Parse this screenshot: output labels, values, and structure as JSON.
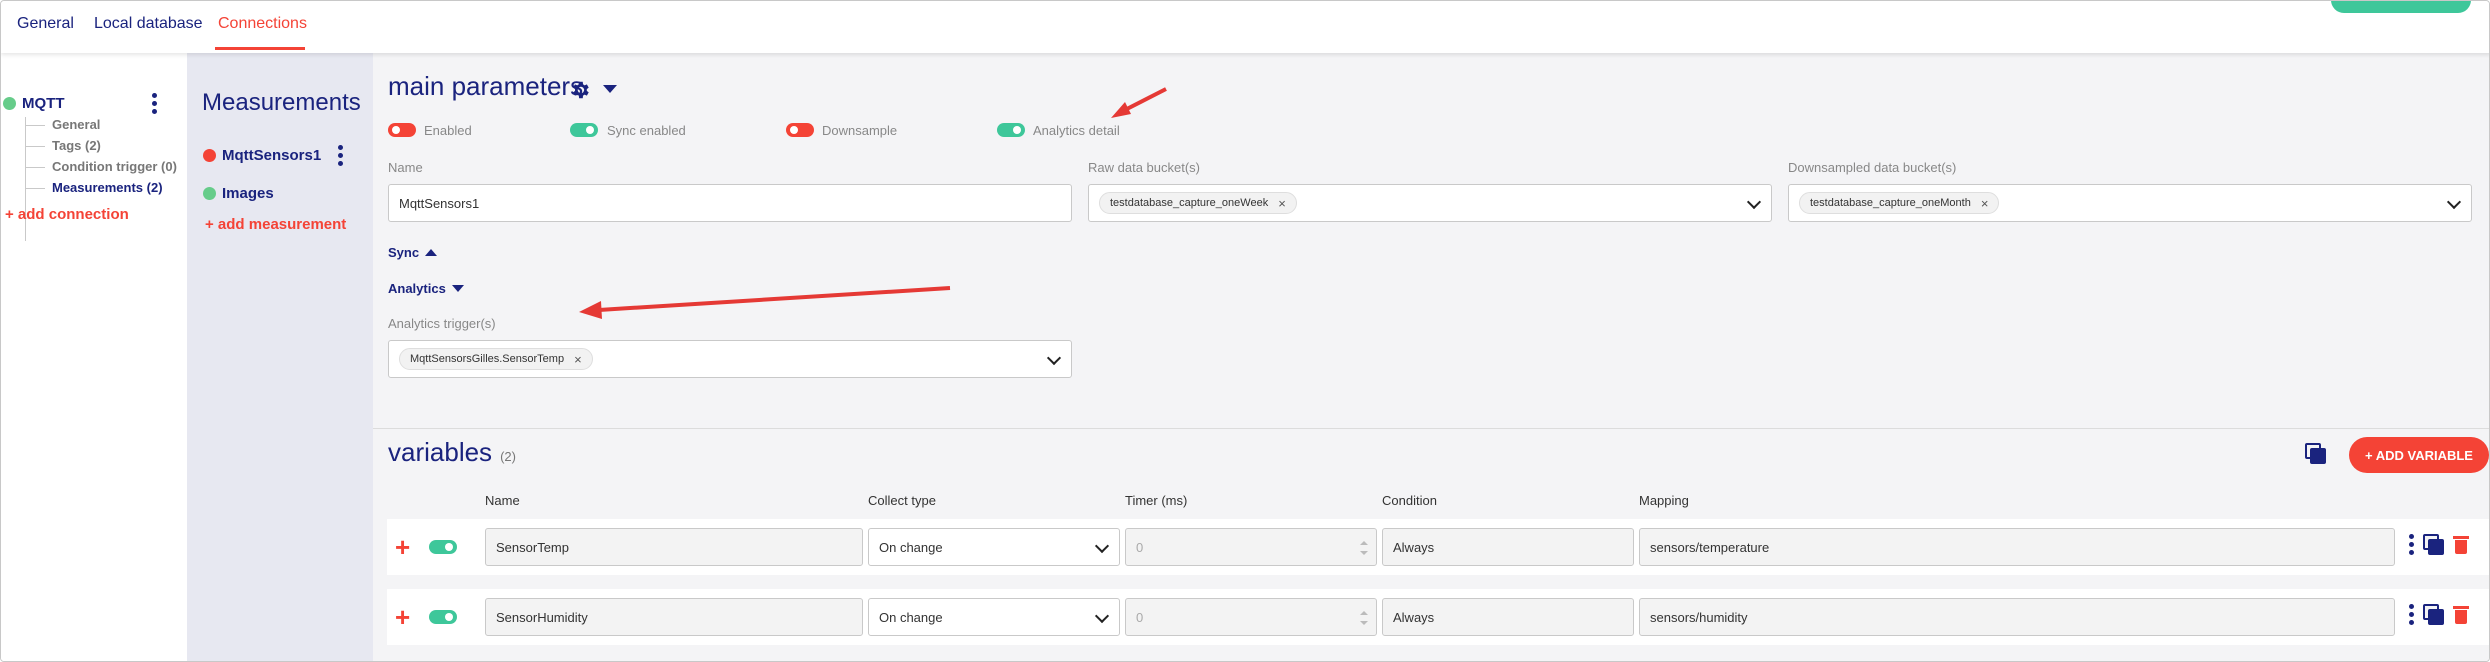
{
  "top_tabs": [
    {
      "label": "General"
    },
    {
      "label": "Local database"
    },
    {
      "label": "Connections"
    }
  ],
  "tree": {
    "root_label": "MQTT",
    "items": [
      {
        "label": "General"
      },
      {
        "label": "Tags (2)"
      },
      {
        "label": "Condition trigger (0)"
      },
      {
        "label": "Measurements (2)"
      }
    ],
    "add_label": "+ add connection"
  },
  "measurements": {
    "title": "Measurements",
    "items": [
      {
        "label": "MqttSensors1",
        "status": "red"
      },
      {
        "label": "Images",
        "status": "green"
      }
    ],
    "add_label": "+ add measurement"
  },
  "main": {
    "title": "main parameters",
    "toggles": [
      {
        "label": "Enabled",
        "state": "off"
      },
      {
        "label": "Sync enabled",
        "state": "on"
      },
      {
        "label": "Downsample",
        "state": "off"
      },
      {
        "label": "Analytics detail",
        "state": "on"
      }
    ],
    "name_label": "Name",
    "name_value": "MqttSensors1",
    "raw_bucket_label": "Raw data bucket(s)",
    "raw_bucket_chip": "testdatabase_capture_oneWeek",
    "down_bucket_label": "Downsampled data bucket(s)",
    "down_bucket_chip": "testdatabase_capture_oneMonth",
    "sync_label": "Sync",
    "analytics_label": "Analytics",
    "analytics_trigger_label": "Analytics trigger(s)",
    "analytics_trigger_chip": "MqttSensorsGilles.SensorTemp",
    "chip_remove": "×"
  },
  "variables": {
    "title": "variables",
    "count": "(2)",
    "add_label": "+ ADD VARIABLE",
    "columns": [
      "Name",
      "Collect type",
      "Timer (ms)",
      "Condition",
      "Mapping"
    ],
    "rows": [
      {
        "name": "SensorTemp",
        "collect_type": "On change",
        "timer": "0",
        "condition": "Always",
        "mapping": "sensors/temperature",
        "enabled": true
      },
      {
        "name": "SensorHumidity",
        "collect_type": "On change",
        "timer": "0",
        "condition": "Always",
        "mapping": "sensors/humidity",
        "enabled": true
      }
    ],
    "plus_symbol": "+"
  },
  "colors": {
    "brand_navy": "#1a237e",
    "accent_red": "#f44336",
    "accent_green": "#3ec79a"
  }
}
